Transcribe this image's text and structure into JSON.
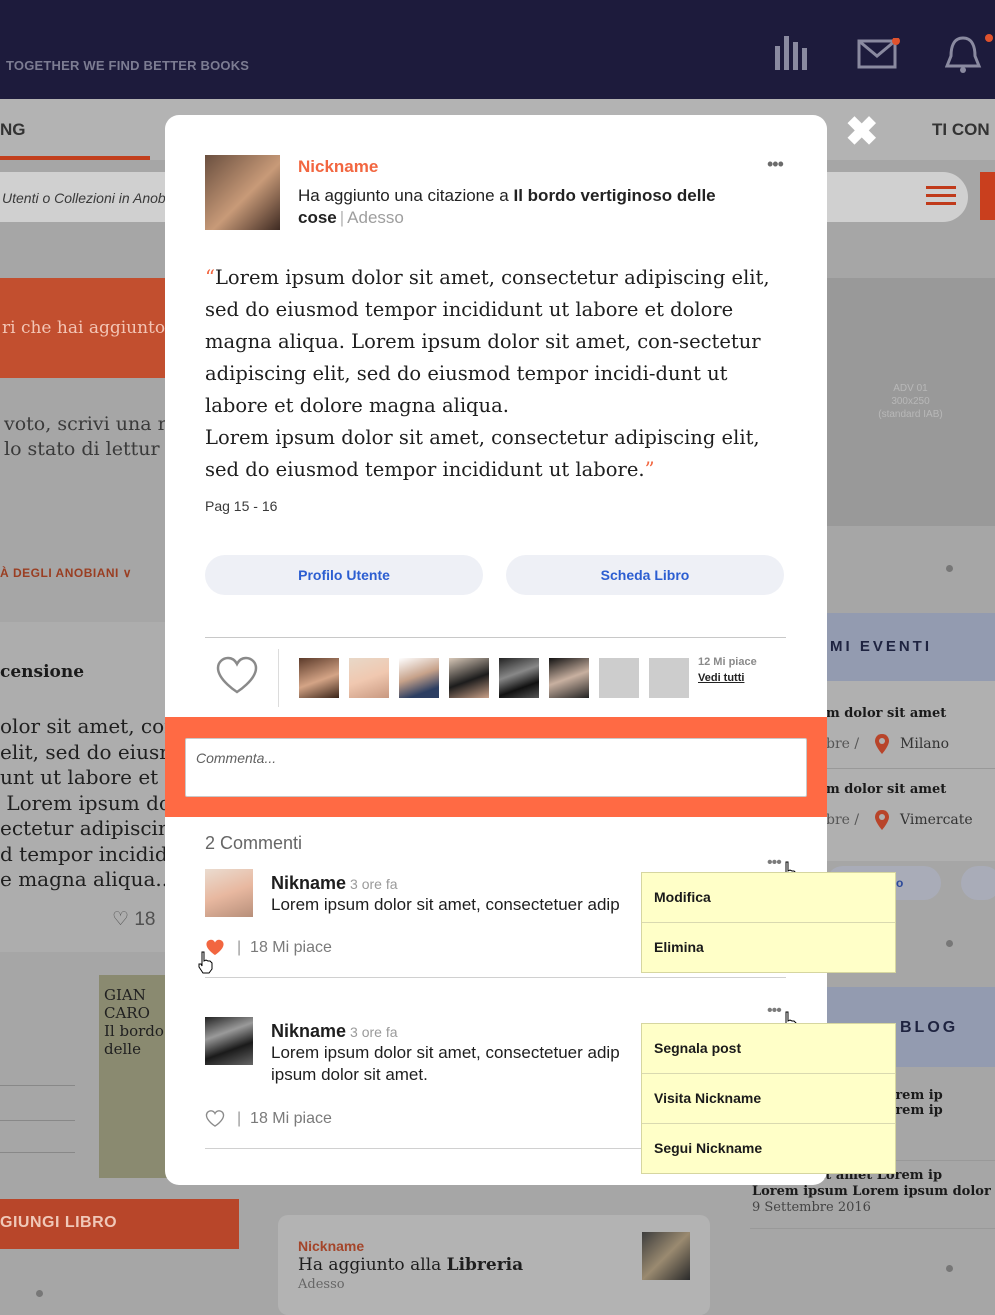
{
  "header": {
    "tagline": "TOGETHER WE FIND BETTER BOOKS",
    "tab_left": "NG",
    "tab_right": "TI CON"
  },
  "background": {
    "search_placeholder": "Utenti o Collezioni in Anobi",
    "banner_text": "ri che hai aggiunto a",
    "vote_text": "voto, scrivi una r\nlo stato di lettur",
    "adv_text": "ADV 01\n300x250\n(standard IAB)",
    "anobiani_link": "À DEGLI ANOBIANI",
    "recensione": "censione",
    "left_lorem": "olor sit amet, cor\nelit, sed do eiusm\nunt ut labore et d\n Lorem ipsum dol\nectetur adipiscing\nd tempor incidid\ne magna aliqua...",
    "left_likes": "18",
    "book_text": "GIAN\nCARO\nIl bordo v\ndelle",
    "add_book": "GIUNGI LIBRO",
    "events_title": "MI EVENTI",
    "events": [
      {
        "title": "m dolor sit amet",
        "date": "bre /",
        "city": "Milano"
      },
      {
        "title": "m dolor sit amet",
        "date": "bre /",
        "city": "Vimercate"
      }
    ],
    "events_btn": "o",
    "blog_title": "BLOG",
    "blog_entries": [
      {
        "text": "t amet Lorem ip\nt amet Lorem ip"
      },
      {
        "text": "m dolor sit amet Lorem ip\nLorem ipsum Lorem ipsum dolor sit a",
        "date": "9 Settembre 2016"
      }
    ],
    "feed_card": {
      "nickname": "Nickname",
      "action": "Ha aggiunto alla",
      "target": "Libreria",
      "time": "Adesso"
    }
  },
  "modal": {
    "close_label": "✖",
    "post": {
      "nickname": "Nickname",
      "action": "Ha aggiunto una citazione a",
      "book_title": "Il bordo vertiginoso delle cose",
      "time": "Adesso",
      "more": "•••",
      "quote": "Lorem ipsum dolor sit amet, consectetur adipiscing elit, sed do eiusmod tempor incididunt ut labore et dolore magna aliqua. Lorem ipsum dolor sit amet, con-sectetur adipiscing elit, sed do eiusmod tempor incidi-dunt ut labore et dolore magna aliqua.\nLorem ipsum dolor sit amet, consectetur adipiscing elit, sed do eiusmod tempor incididunt ut labore.",
      "page_ref": "Pag 15 - 16",
      "btn_profile": "Profilo Utente",
      "btn_book": "Scheda Libro",
      "likes_count": "12 Mi piace",
      "likes_all": "Vedi tutti"
    },
    "comment_placeholder": "Commenta...",
    "comments_count": "2 Commenti",
    "comments": [
      {
        "name": "Nikname",
        "time": "3 ore fa",
        "text": "Lorem ipsum dolor sit amet, consectetuer adip",
        "likes": "18 Mi piace",
        "liked": true,
        "menu": [
          "Modifica",
          "Elimina"
        ]
      },
      {
        "name": "Nikname",
        "time": "3 ore fa",
        "text": "Lorem ipsum dolor sit amet, consectetuer adip\nipsum dolor sit amet.",
        "likes": "18 Mi piace",
        "liked": false,
        "menu": [
          "Segnala post",
          "Visita Nickname",
          "Segui Nickname"
        ]
      }
    ]
  },
  "colors": {
    "accent": "#f26640",
    "link": "#2c5ed1",
    "navy": "#1d1b3c",
    "dropdown": "#ffffc8"
  }
}
